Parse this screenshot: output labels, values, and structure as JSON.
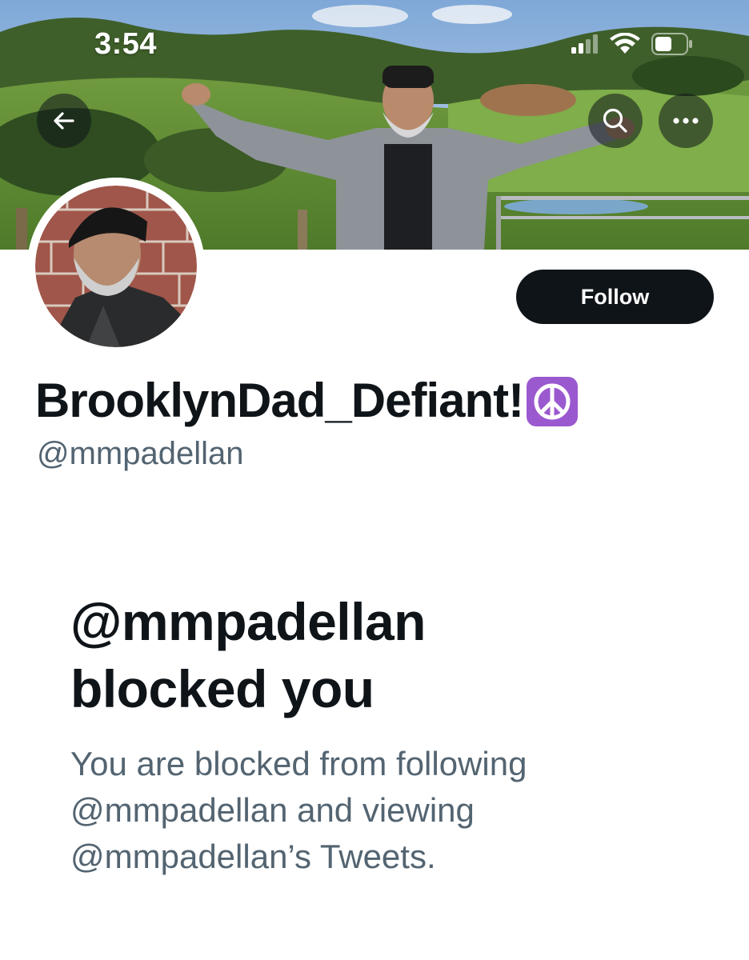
{
  "status_bar": {
    "time": "3:54",
    "icons": [
      "cellular-signal-icon",
      "wifi-icon",
      "battery-icon"
    ]
  },
  "header": {
    "back_icon": "arrow-left-icon",
    "search_icon": "search-icon",
    "more_icon": "more-horizontal-icon"
  },
  "profile": {
    "display_name": "BrooklynDad_Defiant!",
    "name_emoji": "peace-symbol-icon",
    "handle": "@mmpadellan",
    "follow_label": "Follow"
  },
  "blocked": {
    "title_line1": "@mmpadellan",
    "title_line2": "blocked you",
    "desc_line1": "You are blocked from following",
    "desc_line2": "@mmpadellan and viewing",
    "desc_line3": "@mmpadellan’s Tweets."
  },
  "colors": {
    "primary_text": "#0f1419",
    "secondary_text": "#536471",
    "follow_button_bg": "#0f1419",
    "emoji_purple": "#9b59d0"
  }
}
